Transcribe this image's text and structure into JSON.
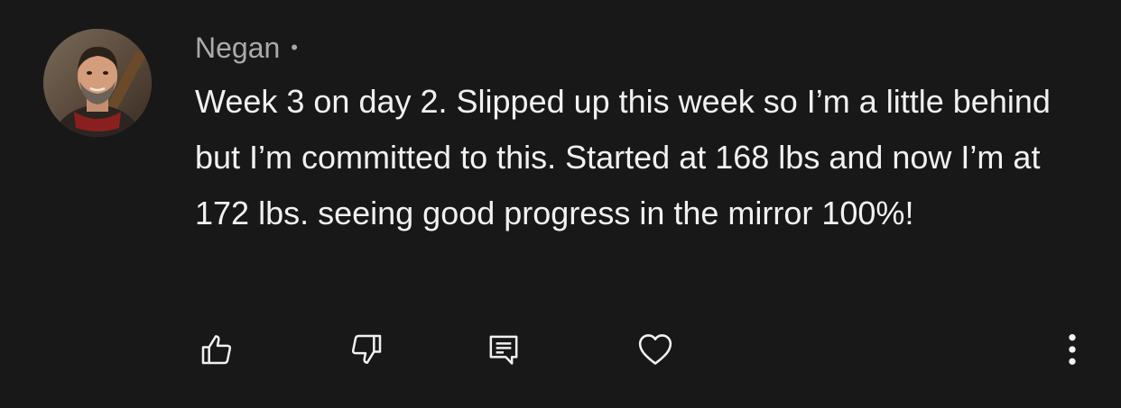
{
  "comment": {
    "author": "Negan",
    "separator": "•",
    "text": "Week 3 on day 2. Slipped up this week so I’m a little behind but I’m committed to this. Started at 168 lbs and now I’m at 172 lbs. seeing good progress in the mirror 100%!"
  },
  "actions": {
    "like_icon": "thumbs-up-icon",
    "dislike_icon": "thumbs-down-icon",
    "reply_icon": "comment-reply-icon",
    "heart_icon": "heart-icon",
    "more_icon": "more-vertical-icon"
  },
  "colors": {
    "background": "#181818",
    "text_primary": "#f1f1f1",
    "text_secondary": "#aaaaaa",
    "icon": "#f1f1f1"
  }
}
